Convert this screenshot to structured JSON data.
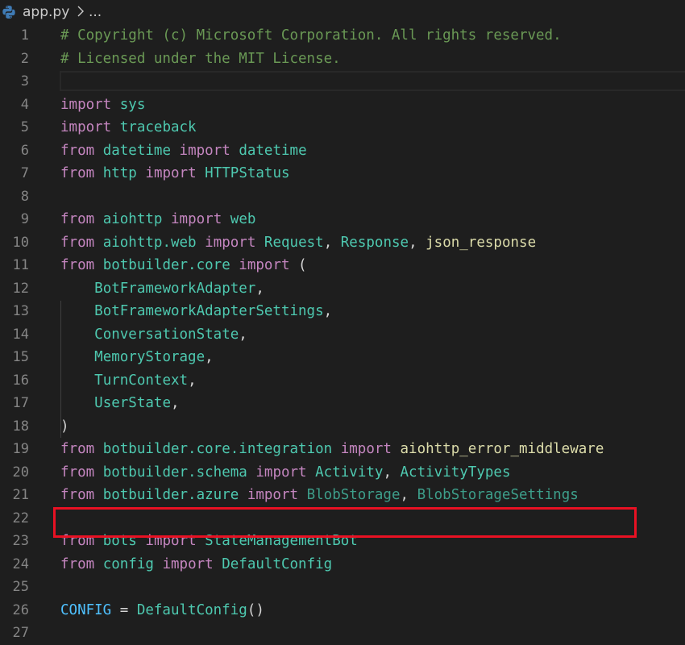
{
  "breadcrumb": {
    "file_icon": "python-icon",
    "file_name": "app.py",
    "separator_icon": "chevron-right-icon",
    "rest": "..."
  },
  "colors": {
    "background": "#1e1e1e",
    "comment": "#6a9955",
    "keyword": "#c586c0",
    "module": "#4ec9b0",
    "function": "#dcdcaa",
    "constant": "#4fc1ff",
    "line_number": "#858585",
    "highlight_box": "#e81123"
  },
  "highlighted_line": 21,
  "lines": [
    {
      "n": "1",
      "tokens": [
        [
          "c",
          "# Copyright (c) Microsoft Corporation. All rights reserved."
        ]
      ]
    },
    {
      "n": "2",
      "tokens": [
        [
          "c",
          "# Licensed under the MIT License."
        ]
      ]
    },
    {
      "n": "3",
      "tokens": []
    },
    {
      "n": "4",
      "tokens": [
        [
          "k",
          "import"
        ],
        [
          "p",
          " "
        ],
        [
          "m",
          "sys"
        ]
      ]
    },
    {
      "n": "5",
      "tokens": [
        [
          "k",
          "import"
        ],
        [
          "p",
          " "
        ],
        [
          "m",
          "traceback"
        ]
      ]
    },
    {
      "n": "6",
      "tokens": [
        [
          "k",
          "from"
        ],
        [
          "p",
          " "
        ],
        [
          "m",
          "datetime"
        ],
        [
          "p",
          " "
        ],
        [
          "k",
          "import"
        ],
        [
          "p",
          " "
        ],
        [
          "m",
          "datetime"
        ]
      ]
    },
    {
      "n": "7",
      "tokens": [
        [
          "k",
          "from"
        ],
        [
          "p",
          " "
        ],
        [
          "m",
          "http"
        ],
        [
          "p",
          " "
        ],
        [
          "k",
          "import"
        ],
        [
          "p",
          " "
        ],
        [
          "m",
          "HTTPStatus"
        ]
      ]
    },
    {
      "n": "8",
      "tokens": []
    },
    {
      "n": "9",
      "tokens": [
        [
          "k",
          "from"
        ],
        [
          "p",
          " "
        ],
        [
          "m",
          "aiohttp"
        ],
        [
          "p",
          " "
        ],
        [
          "k",
          "import"
        ],
        [
          "p",
          " "
        ],
        [
          "m",
          "web"
        ]
      ]
    },
    {
      "n": "10",
      "tokens": [
        [
          "k",
          "from"
        ],
        [
          "p",
          " "
        ],
        [
          "m",
          "aiohttp.web"
        ],
        [
          "p",
          " "
        ],
        [
          "k",
          "import"
        ],
        [
          "p",
          " "
        ],
        [
          "m",
          "Request"
        ],
        [
          "p",
          ", "
        ],
        [
          "m",
          "Response"
        ],
        [
          "p",
          ", "
        ],
        [
          "f",
          "json_response"
        ]
      ]
    },
    {
      "n": "11",
      "tokens": [
        [
          "k",
          "from"
        ],
        [
          "p",
          " "
        ],
        [
          "m",
          "botbuilder.core"
        ],
        [
          "p",
          " "
        ],
        [
          "k",
          "import"
        ],
        [
          "p",
          " ("
        ]
      ]
    },
    {
      "n": "12",
      "tokens": [
        [
          "p",
          "    "
        ],
        [
          "m",
          "BotFrameworkAdapter"
        ],
        [
          "p",
          ","
        ]
      ]
    },
    {
      "n": "13",
      "tokens": [
        [
          "p",
          "    "
        ],
        [
          "m",
          "BotFrameworkAdapterSettings"
        ],
        [
          "p",
          ","
        ]
      ]
    },
    {
      "n": "14",
      "tokens": [
        [
          "p",
          "    "
        ],
        [
          "m",
          "ConversationState"
        ],
        [
          "p",
          ","
        ]
      ]
    },
    {
      "n": "15",
      "tokens": [
        [
          "p",
          "    "
        ],
        [
          "m",
          "MemoryStorage"
        ],
        [
          "p",
          ","
        ]
      ]
    },
    {
      "n": "16",
      "tokens": [
        [
          "p",
          "    "
        ],
        [
          "m",
          "TurnContext"
        ],
        [
          "p",
          ","
        ]
      ]
    },
    {
      "n": "17",
      "tokens": [
        [
          "p",
          "    "
        ],
        [
          "m",
          "UserState"
        ],
        [
          "p",
          ","
        ]
      ]
    },
    {
      "n": "18",
      "tokens": [
        [
          "p",
          ")"
        ]
      ]
    },
    {
      "n": "19",
      "tokens": [
        [
          "k",
          "from"
        ],
        [
          "p",
          " "
        ],
        [
          "m",
          "botbuilder.core.integration"
        ],
        [
          "p",
          " "
        ],
        [
          "k",
          "import"
        ],
        [
          "p",
          " "
        ],
        [
          "f",
          "aiohttp_error_middleware"
        ]
      ]
    },
    {
      "n": "20",
      "tokens": [
        [
          "k",
          "from"
        ],
        [
          "p",
          " "
        ],
        [
          "m",
          "botbuilder.schema"
        ],
        [
          "p",
          " "
        ],
        [
          "k",
          "import"
        ],
        [
          "p",
          " "
        ],
        [
          "m",
          "Activity"
        ],
        [
          "p",
          ", "
        ],
        [
          "m",
          "ActivityTypes"
        ]
      ]
    },
    {
      "n": "21",
      "tokens": [
        [
          "k",
          "from"
        ],
        [
          "p",
          " "
        ],
        [
          "m",
          "botbuilder.azure"
        ],
        [
          "p",
          " "
        ],
        [
          "k",
          "import"
        ],
        [
          "p",
          " "
        ],
        [
          "d",
          "BlobStorage"
        ],
        [
          "p",
          ", "
        ],
        [
          "d",
          "BlobStorageSettings"
        ]
      ]
    },
    {
      "n": "22",
      "tokens": []
    },
    {
      "n": "23",
      "tokens": [
        [
          "k",
          "from"
        ],
        [
          "p",
          " "
        ],
        [
          "m",
          "bots"
        ],
        [
          "p",
          " "
        ],
        [
          "k",
          "import"
        ],
        [
          "p",
          " "
        ],
        [
          "m",
          "StateManagementBot"
        ]
      ]
    },
    {
      "n": "24",
      "tokens": [
        [
          "k",
          "from"
        ],
        [
          "p",
          " "
        ],
        [
          "m",
          "config"
        ],
        [
          "p",
          " "
        ],
        [
          "k",
          "import"
        ],
        [
          "p",
          " "
        ],
        [
          "m",
          "DefaultConfig"
        ]
      ]
    },
    {
      "n": "25",
      "tokens": []
    },
    {
      "n": "26",
      "tokens": [
        [
          "x",
          "CONFIG"
        ],
        [
          "p",
          " = "
        ],
        [
          "m",
          "DefaultConfig"
        ],
        [
          "p",
          "()"
        ]
      ]
    },
    {
      "n": "27",
      "tokens": []
    }
  ]
}
